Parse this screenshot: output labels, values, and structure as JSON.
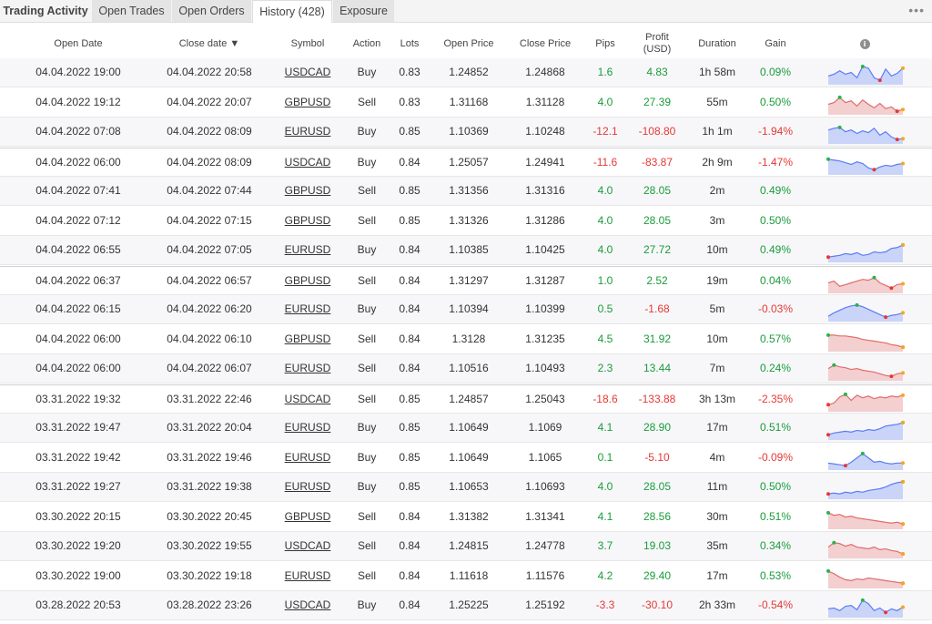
{
  "tabs": [
    "Trading Activity",
    "Open Trades",
    "Open Orders",
    "History (428)",
    "Exposure"
  ],
  "more_label": "•••",
  "columns": {
    "open_date": "Open Date",
    "close_date": "Close date ▼",
    "symbol": "Symbol",
    "action": "Action",
    "lots": "Lots",
    "open_price": "Open Price",
    "close_price": "Close Price",
    "pips": "Pips",
    "profit": "Profit",
    "profit_unit": "(USD)",
    "duration": "Duration",
    "gain": "Gain",
    "info_icon": "i"
  },
  "colors": {
    "positive": "#1a9c3a",
    "negative": "#e53935",
    "spark_up_line": "#5b7cf5",
    "spark_up_fill": "#c9d4f8",
    "spark_down_line": "#e06c6c",
    "spark_down_fill": "#f3cfcf"
  },
  "trades": [
    {
      "open": "04.04.2022 19:00",
      "close": "04.04.2022 20:58",
      "symbol": "USDCAD",
      "action": "Buy",
      "lots": "0.83",
      "open_price": "1.24852",
      "close_price": "1.24868",
      "pips": "1.6",
      "profit": "4.83",
      "duration": "1h 58m",
      "gain": "0.09%",
      "spark": [
        0.4,
        0.5,
        0.7,
        0.5,
        0.6,
        0.3,
        0.95,
        0.85,
        0.3,
        0.15,
        0.8,
        0.4,
        0.55,
        0.85
      ],
      "spark_dir": "up"
    },
    {
      "open": "04.04.2022 19:12",
      "close": "04.04.2022 20:07",
      "symbol": "GBPUSD",
      "action": "Sell",
      "lots": "0.83",
      "open_price": "1.31168",
      "close_price": "1.31128",
      "pips": "4.0",
      "profit": "27.39",
      "duration": "55m",
      "gain": "0.50%",
      "spark": [
        0.5,
        0.6,
        0.9,
        0.6,
        0.7,
        0.4,
        0.75,
        0.5,
        0.3,
        0.55,
        0.25,
        0.35,
        0.1,
        0.2
      ],
      "spark_dir": "down"
    },
    {
      "open": "04.04.2022 07:08",
      "close": "04.04.2022 08:09",
      "symbol": "EURUSD",
      "action": "Buy",
      "lots": "0.85",
      "open_price": "1.10369",
      "close_price": "1.10248",
      "pips": "-12.1",
      "profit": "-108.80",
      "duration": "1h 1m",
      "gain": "-1.94%",
      "spark": [
        0.7,
        0.8,
        0.85,
        0.6,
        0.7,
        0.5,
        0.65,
        0.55,
        0.8,
        0.4,
        0.6,
        0.3,
        0.15,
        0.2
      ],
      "spark_dir": "up"
    },
    {
      "open": "04.04.2022 06:00",
      "close": "04.04.2022 08:09",
      "symbol": "USDCAD",
      "action": "Buy",
      "lots": "0.84",
      "open_price": "1.25057",
      "close_price": "1.24941",
      "pips": "-11.6",
      "profit": "-83.87",
      "duration": "2h 9m",
      "gain": "-1.47%",
      "spark": [
        0.8,
        0.75,
        0.7,
        0.6,
        0.5,
        0.65,
        0.55,
        0.3,
        0.2,
        0.35,
        0.45,
        0.4,
        0.5,
        0.55
      ],
      "spark_dir": "up"
    },
    {
      "open": "04.04.2022 07:41",
      "close": "04.04.2022 07:44",
      "symbol": "GBPUSD",
      "action": "Sell",
      "lots": "0.85",
      "open_price": "1.31356",
      "close_price": "1.31316",
      "pips": "4.0",
      "profit": "28.05",
      "duration": "2m",
      "gain": "0.49%",
      "spark": [],
      "spark_dir": "none"
    },
    {
      "open": "04.04.2022 07:12",
      "close": "04.04.2022 07:15",
      "symbol": "GBPUSD",
      "action": "Sell",
      "lots": "0.85",
      "open_price": "1.31326",
      "close_price": "1.31286",
      "pips": "4.0",
      "profit": "28.05",
      "duration": "3m",
      "gain": "0.50%",
      "spark": [],
      "spark_dir": "none"
    },
    {
      "open": "04.04.2022 06:55",
      "close": "04.04.2022 07:05",
      "symbol": "EURUSD",
      "action": "Buy",
      "lots": "0.84",
      "open_price": "1.10385",
      "close_price": "1.10425",
      "pips": "4.0",
      "profit": "27.72",
      "duration": "10m",
      "gain": "0.49%",
      "spark": [
        0.2,
        0.25,
        0.3,
        0.4,
        0.35,
        0.45,
        0.3,
        0.35,
        0.5,
        0.45,
        0.5,
        0.7,
        0.75,
        0.9
      ],
      "spark_dir": "up"
    },
    {
      "open": "04.04.2022 06:37",
      "close": "04.04.2022 06:57",
      "symbol": "GBPUSD",
      "action": "Sell",
      "lots": "0.84",
      "open_price": "1.31297",
      "close_price": "1.31287",
      "pips": "1.0",
      "profit": "2.52",
      "duration": "19m",
      "gain": "0.04%",
      "spark": [
        0.5,
        0.6,
        0.3,
        0.4,
        0.5,
        0.6,
        0.7,
        0.65,
        0.8,
        0.5,
        0.35,
        0.2,
        0.4,
        0.45
      ],
      "spark_dir": "down"
    },
    {
      "open": "04.04.2022 06:15",
      "close": "04.04.2022 06:20",
      "symbol": "EURUSD",
      "action": "Buy",
      "lots": "0.84",
      "open_price": "1.10394",
      "close_price": "1.10399",
      "pips": "0.5",
      "profit": "-1.68",
      "duration": "5m",
      "gain": "-0.03%",
      "spark": [
        0.2,
        0.4,
        0.55,
        0.7,
        0.8,
        0.85,
        0.75,
        0.6,
        0.45,
        0.3,
        0.15,
        0.25,
        0.3,
        0.4
      ],
      "spark_dir": "up"
    },
    {
      "open": "04.04.2022 06:00",
      "close": "04.04.2022 06:10",
      "symbol": "GBPUSD",
      "action": "Sell",
      "lots": "0.84",
      "open_price": "1.3128",
      "close_price": "1.31235",
      "pips": "4.5",
      "profit": "31.92",
      "duration": "10m",
      "gain": "0.57%",
      "spark": [
        0.85,
        0.85,
        0.8,
        0.8,
        0.75,
        0.7,
        0.6,
        0.55,
        0.5,
        0.45,
        0.4,
        0.3,
        0.25,
        0.15
      ],
      "spark_dir": "down"
    },
    {
      "open": "04.04.2022 06:00",
      "close": "04.04.2022 06:07",
      "symbol": "EURUSD",
      "action": "Sell",
      "lots": "0.84",
      "open_price": "1.10516",
      "close_price": "1.10493",
      "pips": "2.3",
      "profit": "13.44",
      "duration": "7m",
      "gain": "0.24%",
      "spark": [
        0.6,
        0.8,
        0.7,
        0.65,
        0.55,
        0.6,
        0.5,
        0.45,
        0.4,
        0.3,
        0.2,
        0.15,
        0.3,
        0.35
      ],
      "spark_dir": "down"
    },
    {
      "open": "03.31.2022 19:32",
      "close": "03.31.2022 22:46",
      "symbol": "USDCAD",
      "action": "Sell",
      "lots": "0.85",
      "open_price": "1.24857",
      "close_price": "1.25043",
      "pips": "-18.6",
      "profit": "-133.88",
      "duration": "3h 13m",
      "gain": "-2.35%",
      "spark": [
        0.3,
        0.4,
        0.75,
        0.9,
        0.55,
        0.85,
        0.7,
        0.8,
        0.65,
        0.75,
        0.7,
        0.8,
        0.75,
        0.85
      ],
      "spark_dir": "down"
    },
    {
      "open": "03.31.2022 19:47",
      "close": "03.31.2022 20:04",
      "symbol": "EURUSD",
      "action": "Buy",
      "lots": "0.85",
      "open_price": "1.10649",
      "close_price": "1.1069",
      "pips": "4.1",
      "profit": "28.90",
      "duration": "17m",
      "gain": "0.51%",
      "spark": [
        0.2,
        0.3,
        0.35,
        0.4,
        0.35,
        0.45,
        0.4,
        0.5,
        0.45,
        0.55,
        0.7,
        0.75,
        0.8,
        0.9
      ],
      "spark_dir": "up"
    },
    {
      "open": "03.31.2022 19:42",
      "close": "03.31.2022 19:46",
      "symbol": "EURUSD",
      "action": "Buy",
      "lots": "0.85",
      "open_price": "1.10649",
      "close_price": "1.1065",
      "pips": "0.1",
      "profit": "-5.10",
      "duration": "4m",
      "gain": "-0.09%",
      "spark": [
        0.3,
        0.25,
        0.2,
        0.15,
        0.35,
        0.6,
        0.85,
        0.6,
        0.35,
        0.4,
        0.3,
        0.25,
        0.3,
        0.3
      ],
      "spark_dir": "up"
    },
    {
      "open": "03.31.2022 19:27",
      "close": "03.31.2022 19:38",
      "symbol": "EURUSD",
      "action": "Buy",
      "lots": "0.85",
      "open_price": "1.10653",
      "close_price": "1.10693",
      "pips": "4.0",
      "profit": "28.05",
      "duration": "11m",
      "gain": "0.50%",
      "spark": [
        0.2,
        0.25,
        0.2,
        0.3,
        0.25,
        0.35,
        0.3,
        0.4,
        0.45,
        0.5,
        0.6,
        0.75,
        0.85,
        0.9
      ],
      "spark_dir": "up"
    },
    {
      "open": "03.30.2022 20:15",
      "close": "03.30.2022 20:45",
      "symbol": "GBPUSD",
      "action": "Sell",
      "lots": "0.84",
      "open_price": "1.31382",
      "close_price": "1.31341",
      "pips": "4.1",
      "profit": "28.56",
      "duration": "30m",
      "gain": "0.51%",
      "spark": [
        0.85,
        0.7,
        0.75,
        0.6,
        0.65,
        0.55,
        0.5,
        0.45,
        0.4,
        0.35,
        0.3,
        0.25,
        0.3,
        0.2
      ],
      "spark_dir": "down"
    },
    {
      "open": "03.30.2022 19:20",
      "close": "03.30.2022 19:55",
      "symbol": "USDCAD",
      "action": "Sell",
      "lots": "0.84",
      "open_price": "1.24815",
      "close_price": "1.24778",
      "pips": "3.7",
      "profit": "19.03",
      "duration": "35m",
      "gain": "0.34%",
      "spark": [
        0.55,
        0.8,
        0.75,
        0.6,
        0.7,
        0.55,
        0.5,
        0.45,
        0.55,
        0.4,
        0.45,
        0.35,
        0.3,
        0.15
      ],
      "spark_dir": "down"
    },
    {
      "open": "03.30.2022 19:00",
      "close": "03.30.2022 19:18",
      "symbol": "EURUSD",
      "action": "Sell",
      "lots": "0.84",
      "open_price": "1.11618",
      "close_price": "1.11576",
      "pips": "4.2",
      "profit": "29.40",
      "duration": "17m",
      "gain": "0.53%",
      "spark": [
        0.9,
        0.75,
        0.55,
        0.4,
        0.35,
        0.45,
        0.4,
        0.5,
        0.45,
        0.4,
        0.35,
        0.3,
        0.25,
        0.2
      ],
      "spark_dir": "down"
    },
    {
      "open": "03.28.2022 20:53",
      "close": "03.28.2022 23:26",
      "symbol": "USDCAD",
      "action": "Buy",
      "lots": "0.84",
      "open_price": "1.25225",
      "close_price": "1.25192",
      "pips": "-3.3",
      "profit": "-30.10",
      "duration": "2h 33m",
      "gain": "-0.54%",
      "spark": [
        0.4,
        0.45,
        0.3,
        0.55,
        0.6,
        0.35,
        0.9,
        0.7,
        0.3,
        0.45,
        0.2,
        0.4,
        0.3,
        0.5
      ],
      "spark_dir": "up"
    }
  ]
}
